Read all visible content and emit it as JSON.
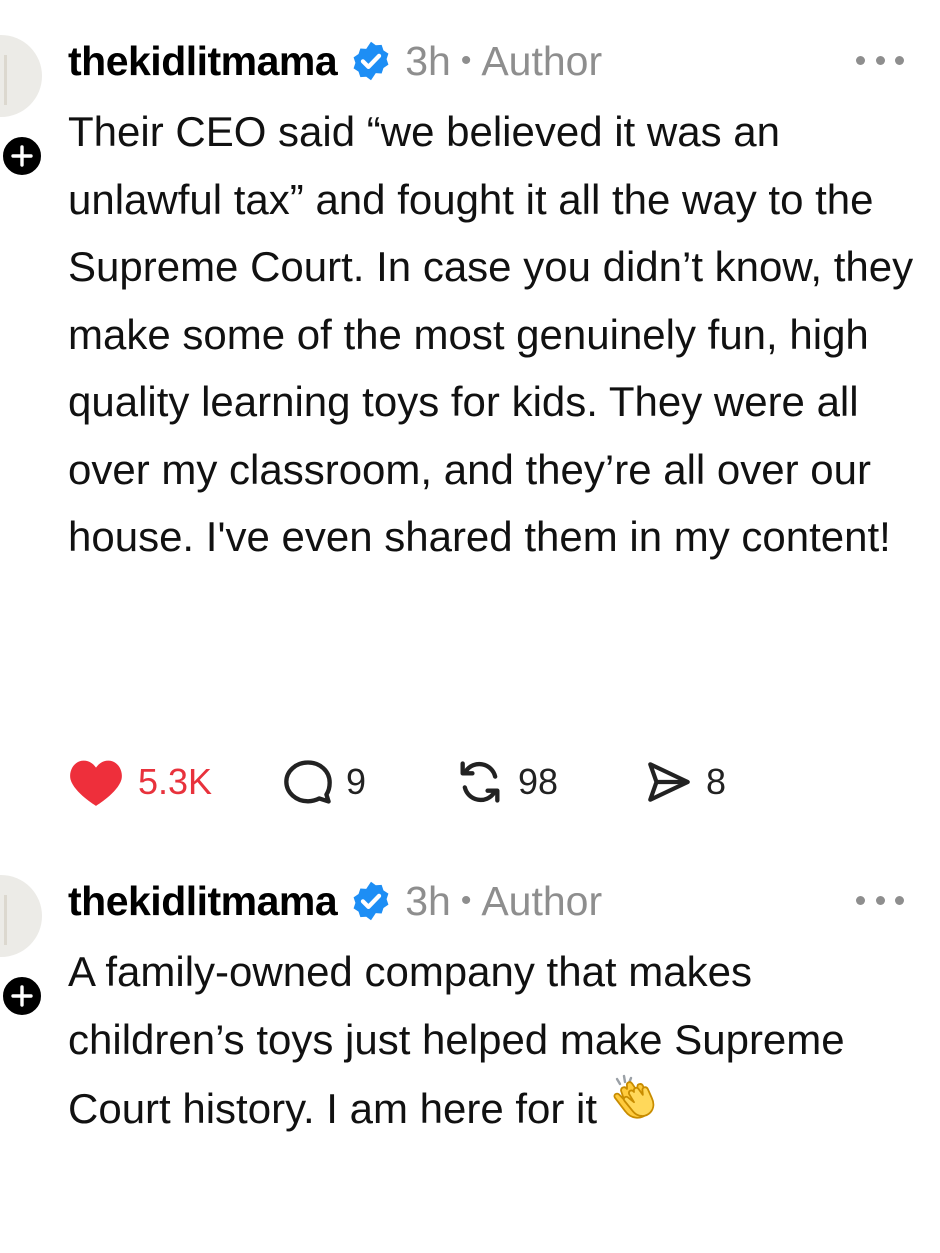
{
  "colors": {
    "like_red": "#ee2f3b",
    "verified_blue": "#1d8ef5",
    "muted_gray": "#8e8e8e",
    "text": "#111111"
  },
  "posts": [
    {
      "username": "thekidlitmama",
      "verified": true,
      "time": "3h",
      "separator": "•",
      "badge": "Author",
      "text": "Their CEO said “we believed it was an unlawful tax” and fought it all the way to the Supreme Court. In case you didn’t know, they make some of the most genuinely fun, high quality learning toys for kids. They were all over my classroom, and they’re all over our house. I've even shared them in my content!",
      "likes": "5.3K",
      "liked": true,
      "replies": "9",
      "reposts": "98",
      "shares": "8"
    },
    {
      "username": "thekidlitmama",
      "verified": true,
      "time": "3h",
      "separator": "•",
      "badge": "Author",
      "text": "A family-owned company that makes children’s toys just helped make Supreme Court history. I am here for it",
      "emoji": "clapping-hands"
    }
  ],
  "icons": {
    "follow": "plus-icon",
    "verified": "verified-badge-icon",
    "more": "more-options-icon",
    "like": "heart-icon",
    "reply": "comment-bubble-icon",
    "repost": "repost-icon",
    "share": "send-icon"
  }
}
